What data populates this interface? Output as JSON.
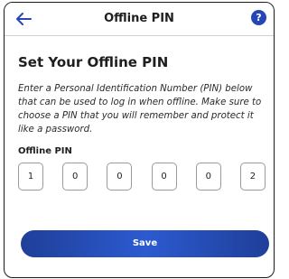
{
  "header": {
    "title": "Offline PIN",
    "back_icon": "arrow-left-icon",
    "help_icon": "question-circle-icon",
    "help_glyph": "?",
    "accent_color": "#2546b8"
  },
  "main": {
    "heading": "Set Your Offline PIN",
    "description": "Enter a Personal Identification Number (PIN) below that can be used to log in when offline. Make sure to choose a PIN that you will remember and protect it like a password.",
    "pin_label": "Offline PIN",
    "pin_digits": [
      "1",
      "0",
      "0",
      "0",
      "0",
      "2"
    ]
  },
  "actions": {
    "save_label": "Save",
    "save_color": "#2546b8"
  }
}
